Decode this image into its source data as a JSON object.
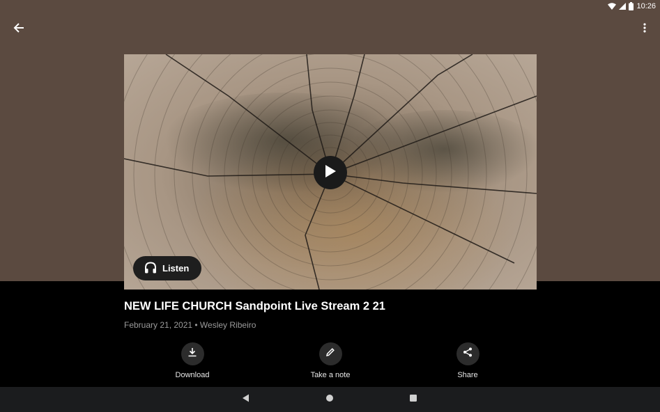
{
  "status_bar": {
    "time": "10:26",
    "icons": [
      "wifi-icon",
      "signal-icon",
      "battery-icon"
    ]
  },
  "toolbar": {
    "back_icon": "arrow-left-icon",
    "overflow_icon": "more-vert-icon"
  },
  "colors": {
    "hero_background": "#5b4a40",
    "content_background": "#000000",
    "nav_background": "#1b1c1e",
    "button_background": "#2c2c2c"
  },
  "media": {
    "play_icon": "play-icon",
    "listen_label": "Listen",
    "listen_icon": "headphones-icon"
  },
  "sermon": {
    "title": "NEW LIFE CHURCH Sandpoint Live Stream 2 21",
    "meta": "February 21, 2021 • Wesley Ribeiro"
  },
  "actions": [
    {
      "label": "Download",
      "icon": "download-icon"
    },
    {
      "label": "Take a note",
      "icon": "pencil-icon"
    },
    {
      "label": "Share",
      "icon": "share-icon"
    }
  ],
  "navigation": {
    "items": [
      "back-triangle-icon",
      "home-circle-icon",
      "recents-square-icon"
    ]
  }
}
